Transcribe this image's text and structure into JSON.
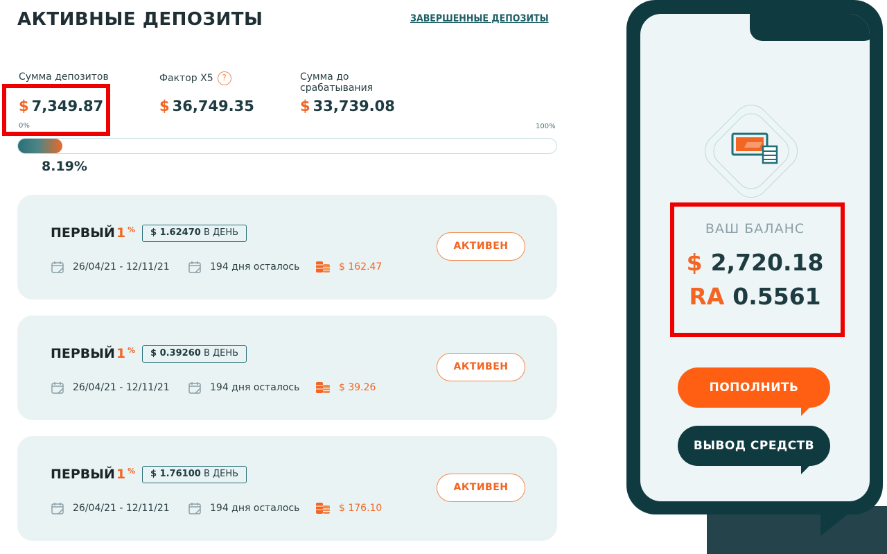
{
  "header": {
    "title": "АКТИВНЫЕ ДЕПОЗИТЫ",
    "completed_link": "ЗАВЕРШЕННЫЕ ДЕПОЗИТЫ"
  },
  "stats": {
    "deposits_sum": {
      "label": "Сумма депозитов",
      "currency": "$",
      "value": "7,349.87"
    },
    "factor": {
      "label": "Фактор X5",
      "help": "?",
      "currency": "$",
      "value": "36,749.35"
    },
    "trigger": {
      "label_line1": "Сумма до",
      "label_line2": "срабатывания",
      "currency": "$",
      "value": "33,739.08"
    }
  },
  "progress": {
    "min_label": "0%",
    "max_label": "100%",
    "value_text": "8.19%",
    "fraction": 0.0819
  },
  "deposits": [
    {
      "name": "ПЕРВЫЙ",
      "rate": "1",
      "pct": "%",
      "per_day": "$ 1.62470",
      "per_day_suffix": "В ДЕНЬ",
      "dates": "26/04/21 - 12/11/21",
      "remaining": "194 дня осталось",
      "earned": "$ 162.47",
      "status": "АКТИВЕН"
    },
    {
      "name": "ПЕРВЫЙ",
      "rate": "1",
      "pct": "%",
      "per_day": "$ 0.39260",
      "per_day_suffix": "В ДЕНЬ",
      "dates": "26/04/21 - 12/11/21",
      "remaining": "194 дня осталось",
      "earned": "$ 39.26",
      "status": "АКТИВЕН"
    },
    {
      "name": "ПЕРВЫЙ",
      "rate": "1",
      "pct": "%",
      "per_day": "$ 1.76100",
      "per_day_suffix": "В ДЕНЬ",
      "dates": "26/04/21 - 12/11/21",
      "remaining": "194 дня осталось",
      "earned": "$ 176.10",
      "status": "АКТИВЕН"
    }
  ],
  "balance": {
    "label": "ВАШ БАЛАНС",
    "usd_currency": "$",
    "usd_value": "2,720.18",
    "ra_currency": "RA",
    "ra_value": "0.5561"
  },
  "actions": {
    "deposit": "ПОПОЛНИТЬ",
    "withdraw": "ВЫВОД СРЕДСТВ"
  },
  "icons": {
    "calendar": "calendar-icon",
    "remaining": "calendar-icon",
    "earned": "coins-icon",
    "balance": "wallet-card-icon"
  },
  "colors": {
    "accent": "#f26522",
    "dark": "#0f3a40",
    "card_bg": "#eaf3f4",
    "highlight": "#ee0000"
  }
}
